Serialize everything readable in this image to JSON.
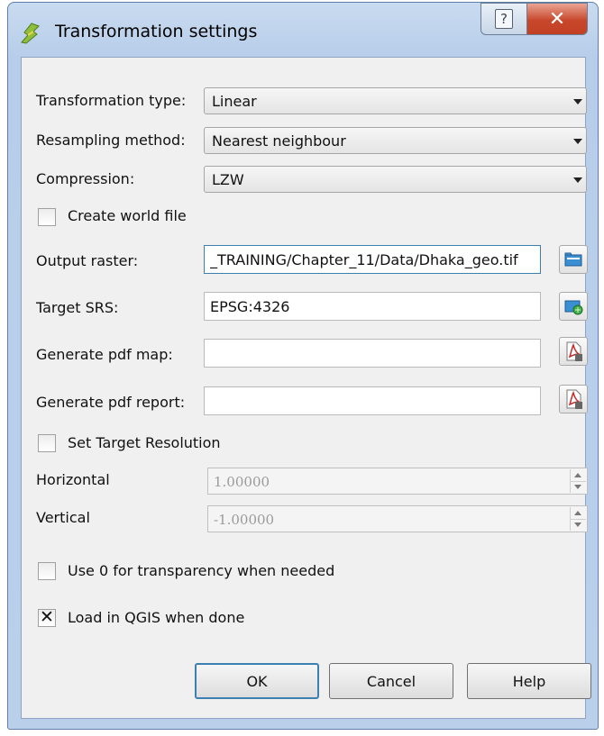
{
  "window": {
    "title": "Transformation settings"
  },
  "form": {
    "transformation_type": {
      "label": "Transformation type:",
      "value": "Linear"
    },
    "resampling_method": {
      "label": "Resampling method:",
      "value": "Nearest neighbour"
    },
    "compression": {
      "label": "Compression:",
      "value": "LZW"
    },
    "create_world_file": {
      "label": "Create world file",
      "checked": false
    },
    "output_raster": {
      "label": "Output raster:",
      "value": "_TRAINING/Chapter_11/Data/Dhaka_geo.tif"
    },
    "target_srs": {
      "label": "Target SRS:",
      "value": "EPSG:4326"
    },
    "pdf_map": {
      "label": "Generate pdf map:",
      "value": ""
    },
    "pdf_report": {
      "label": "Generate pdf report:",
      "value": ""
    },
    "set_target_resolution": {
      "label": "Set Target Resolution",
      "checked": false
    },
    "horizontal": {
      "label": "Horizontal",
      "value": "1.00000"
    },
    "vertical": {
      "label": "Vertical",
      "value": "-1.00000"
    },
    "use_zero_transparency": {
      "label": "Use 0 for transparency when needed",
      "checked": false
    },
    "load_in_qgis": {
      "label": "Load in QGIS when done",
      "checked": true
    }
  },
  "buttons": {
    "ok": "OK",
    "cancel": "Cancel",
    "help": "Help"
  },
  "icons": {
    "app": "qgis-georeferencer-icon",
    "output_raster": "folder-browse-icon",
    "target_srs": "crs-select-icon",
    "pdf_map": "pdf-file-icon",
    "pdf_report": "pdf-file-icon"
  },
  "colors": {
    "close_button": "#c8472c",
    "focus_border": "#3c7fb1",
    "titlebar": "#c0d5ee"
  }
}
